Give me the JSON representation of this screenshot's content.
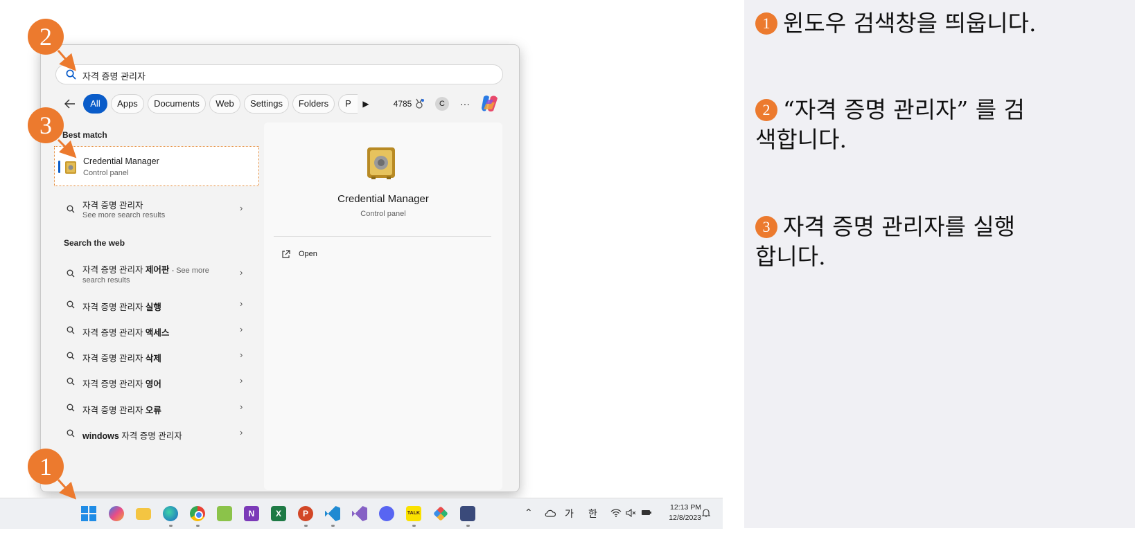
{
  "search": {
    "query": "자격 증명 관리자"
  },
  "filters": {
    "tabs": [
      "All",
      "Apps",
      "Documents",
      "Web",
      "Settings",
      "Folders",
      "P"
    ],
    "play": "▶",
    "points": "4785",
    "account_initial": "C",
    "more": "···"
  },
  "results": {
    "best_match_header": "Best match",
    "best_match": {
      "title": "Credential Manager",
      "subtitle": "Control panel"
    },
    "app_search": {
      "title": "자격 증명 관리자",
      "subtitle": "See more search results"
    },
    "web_header": "Search the web",
    "web_first": {
      "prefix": "자격 증명 관리자 ",
      "bold": "제어판",
      "suffix": " - See more",
      "line2": "search results"
    },
    "web_items": [
      {
        "prefix": "자격 증명 관리자 ",
        "bold": "실행"
      },
      {
        "prefix": "자격 증명 관리자 ",
        "bold": "액세스"
      },
      {
        "prefix": "자격 증명 관리자 ",
        "bold": "삭제"
      },
      {
        "prefix": "자격 증명 관리자 ",
        "bold": "영어"
      },
      {
        "prefix": "자격 증명 관리자 ",
        "bold": "오류"
      }
    ],
    "web_last": {
      "bold": "windows",
      "suffix": " 자격 증명 관리자"
    }
  },
  "detail": {
    "title": "Credential Manager",
    "subtitle": "Control panel",
    "open_label": "Open"
  },
  "taskbar": {
    "apps": [
      "start",
      "copilot-pre",
      "file-explorer",
      "edge",
      "chrome",
      "paint",
      "onenote",
      "excel",
      "powerpoint",
      "vscode",
      "visual-studio",
      "discord",
      "kakaotalk",
      "pinwheel-app",
      "chat-app"
    ],
    "tray_lang1": "가",
    "tray_lang2": "한",
    "time": "12:13 PM",
    "date": "12/8/2023"
  },
  "callouts": [
    "2",
    "3",
    "1"
  ],
  "instructions": [
    {
      "num": "1",
      "text": "윈도우 검색창을 띄웁니다."
    },
    {
      "num": "2",
      "text": "“자격 증명 관리자” 를 검색합니다."
    },
    {
      "num": "3",
      "text": "자격 증명 관리자를 실행합니다."
    }
  ],
  "colors": {
    "accent": "#0a5cc9",
    "callout": "#ec7a2e",
    "panel": "#f3f3f3",
    "instructions_bg": "#f0f0f4"
  }
}
